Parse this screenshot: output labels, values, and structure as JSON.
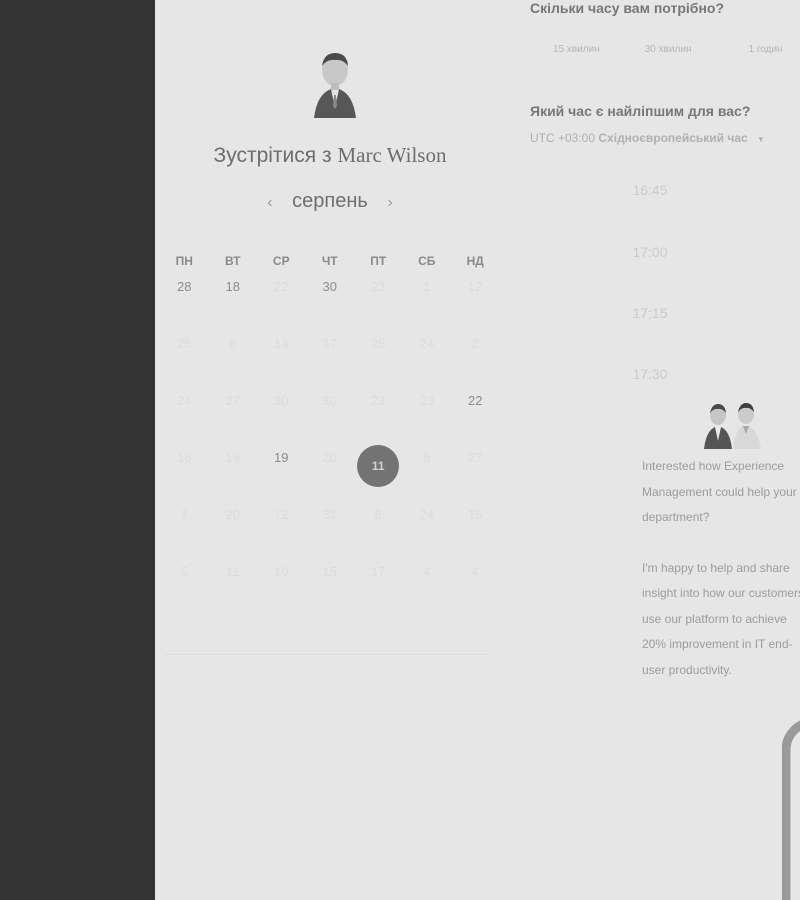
{
  "scheduler": {
    "host_prefix": "Зустрітися з",
    "host_name": "Marc Wilson",
    "month": "серпень",
    "prev_month_icon": "chevron-left-icon",
    "next_month_icon": "chevron-right-icon",
    "weekdays": [
      "ПН",
      "ВТ",
      "СР",
      "ЧТ",
      "ПТ",
      "СБ",
      "НД"
    ],
    "weeks": [
      [
        {
          "d": "28",
          "avail": true
        },
        {
          "d": "18",
          "avail": true
        },
        {
          "d": "22",
          "avail": false
        },
        {
          "d": "30",
          "avail": true
        },
        {
          "d": "23",
          "avail": false
        },
        {
          "d": "1",
          "avail": false
        },
        {
          "d": "12",
          "avail": false
        }
      ],
      [
        {
          "d": "25",
          "avail": false
        },
        {
          "d": "6",
          "avail": false
        },
        {
          "d": "14",
          "avail": false
        },
        {
          "d": "17",
          "avail": false
        },
        {
          "d": "28",
          "avail": false
        },
        {
          "d": "24",
          "avail": false
        },
        {
          "d": "2",
          "avail": false
        }
      ],
      [
        {
          "d": "24",
          "avail": false
        },
        {
          "d": "27",
          "avail": false
        },
        {
          "d": "30",
          "avail": false
        },
        {
          "d": "30",
          "avail": false
        },
        {
          "d": "23",
          "avail": false
        },
        {
          "d": "23",
          "avail": false
        },
        {
          "d": "22",
          "avail": true
        }
      ],
      [
        {
          "d": "18",
          "avail": false
        },
        {
          "d": "19",
          "avail": false
        },
        {
          "d": "19",
          "avail": true
        },
        {
          "d": "20",
          "avail": false
        },
        {
          "d": "11",
          "avail": true,
          "selected": true
        },
        {
          "d": "8",
          "avail": false
        },
        {
          "d": "27",
          "avail": false
        }
      ],
      [
        {
          "d": "7",
          "avail": false
        },
        {
          "d": "20",
          "avail": false
        },
        {
          "d": "12",
          "avail": false
        },
        {
          "d": "31",
          "avail": false
        },
        {
          "d": "6",
          "avail": false
        },
        {
          "d": "24",
          "avail": false
        },
        {
          "d": "15",
          "avail": false
        }
      ],
      [
        {
          "d": "5",
          "avail": false
        },
        {
          "d": "11",
          "avail": false
        },
        {
          "d": "10",
          "avail": false
        },
        {
          "d": "15",
          "avail": false
        },
        {
          "d": "17",
          "avail": false
        },
        {
          "d": "4",
          "avail": false
        },
        {
          "d": "4",
          "avail": false
        }
      ]
    ],
    "duration_question": "Скільки часу вам потрібно?",
    "durations": [
      "15 хвилин",
      "30 хвилин",
      "1 годин"
    ],
    "time_question": "Який час є найліпшим для вас?",
    "timezone_offset": "UTC +03:00",
    "timezone_name": "Східноєвропейський час",
    "timezone_icon": "caret-down-icon",
    "slots": [
      "16:45",
      "17:00",
      "17:15",
      "17:30"
    ],
    "intro_1": "Interested how Experience Management could help your department?",
    "intro_2": "I'm happy to help and share insight into how our customers use our platform to achieve 20% improvement in IT end-user productivity."
  },
  "colors": {
    "sidebar_bg": "#333333",
    "page_bg": "#e6e6e6",
    "selected_day": "#737373"
  }
}
